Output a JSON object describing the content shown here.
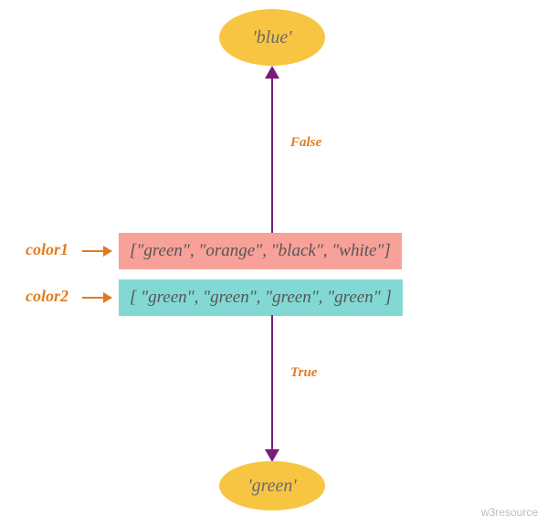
{
  "nodes": {
    "top": "'blue'",
    "bottom": "'green'"
  },
  "labels": {
    "color1": "color1",
    "color2": "color2"
  },
  "lists": {
    "color1_text": "[\"green\", \"orange\", \"black\", \"white\"]",
    "color2_text": "[ \"green\", \"green\", \"green\", \"green\" ]"
  },
  "edges": {
    "up": "False",
    "down": "True"
  },
  "watermark": "w3resource"
}
